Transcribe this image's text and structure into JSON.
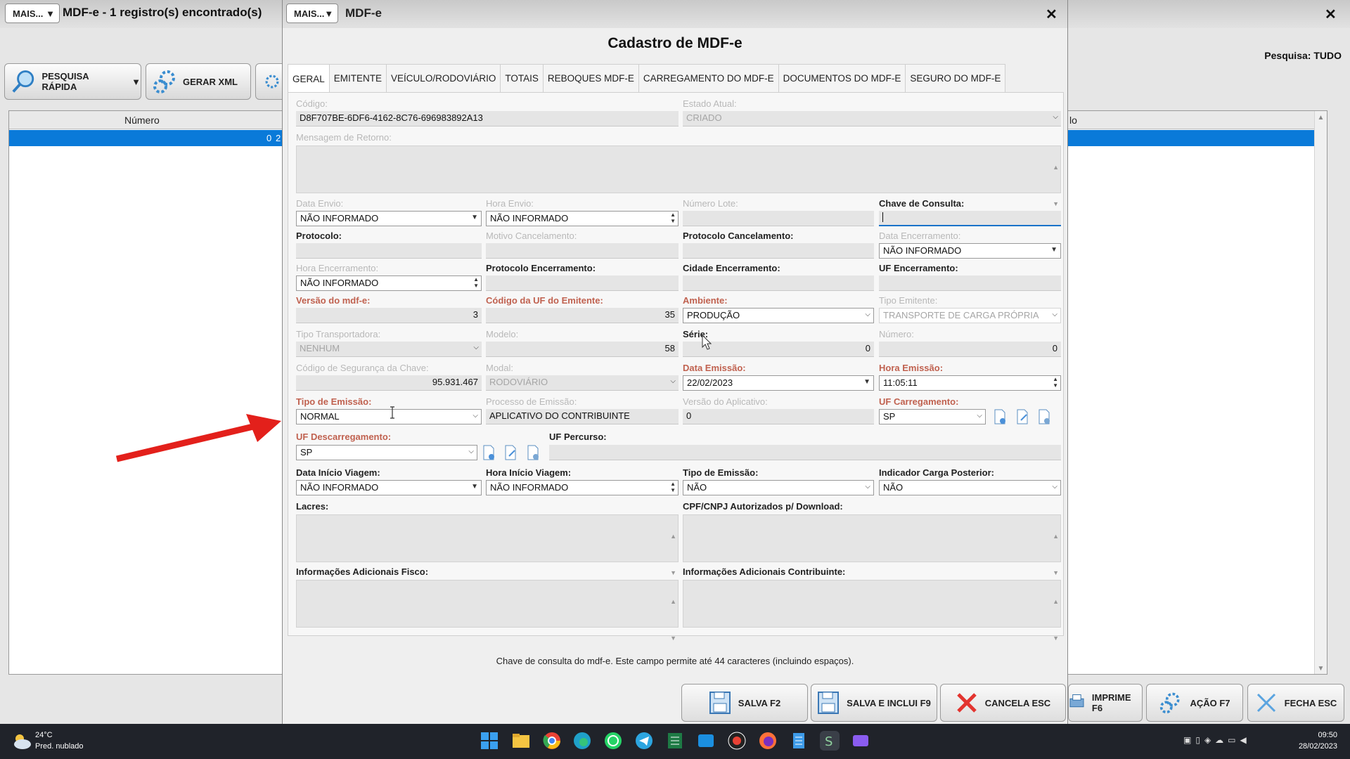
{
  "background_window": {
    "mais_label": "MAIS...",
    "title": "MDF-e - 1 registro(s) encontrado(s)",
    "pesquisa_label": "Pesquisa:",
    "pesquisa_value": "TUDO",
    "toolbar": {
      "pesquisa_rapida": "PESQUISA RÁPIDA",
      "gerar_xml": "GERAR XML"
    },
    "grid": {
      "col_numero": "Número",
      "col_right_partial": "lo",
      "row_value": "0",
      "row_value2": "2"
    },
    "bottom_buttons": {
      "imprime": "IMPRIME F6",
      "acao": "AÇÃO F7",
      "fecha": "FECHA ESC"
    },
    "close_symbol": "✕"
  },
  "modal": {
    "mais_label": "MAIS...",
    "window_title": "MDF-e",
    "dialog_title": "Cadastro de MDF-e",
    "tabs": [
      "GERAL",
      "EMITENTE",
      "VEÍCULO/RODOVIÁRIO",
      "TOTAIS",
      "REBOQUES MDF-E",
      "CARREGAMENTO DO MDF-E",
      "DOCUMENTOS DO MDF-E",
      "SEGURO DO MDF-E"
    ],
    "fields": {
      "codigo_label": "Código:",
      "codigo_value": "D8F707BE-6DF6-4162-8C76-696983892A13",
      "estado_label": "Estado Atual:",
      "estado_value": "CRIADO",
      "mensagem_label": "Mensagem de Retorno:",
      "data_envio_label": "Data Envio:",
      "data_envio_value": "NÃO INFORMADO",
      "hora_envio_label": "Hora Envio:",
      "hora_envio_value": "NÃO INFORMADO",
      "numero_lote_label": "Número Lote:",
      "chave_consulta_label": "Chave de Consulta:",
      "protocolo_label": "Protocolo:",
      "motivo_canc_label": "Motivo Cancelamento:",
      "protocolo_canc_label": "Protocolo Cancelamento:",
      "data_enc_label": "Data Encerramento:",
      "data_enc_value": "NÃO INFORMADO",
      "hora_enc_label": "Hora Encerramento:",
      "hora_enc_value": "NÃO INFORMADO",
      "protocolo_enc_label": "Protocolo Encerramento:",
      "cidade_enc_label": "Cidade Encerramento:",
      "uf_enc_label": "UF Encerramento:",
      "versao_label": "Versão do mdf-e:",
      "versao_value": "3",
      "cod_uf_label": "Código da UF do Emitente:",
      "cod_uf_value": "35",
      "ambiente_label": "Ambiente:",
      "ambiente_value": "PRODUÇÃO",
      "tipo_emitente_label": "Tipo Emitente:",
      "tipo_emitente_value": "TRANSPORTE DE CARGA PRÓPRIA",
      "tipo_transp_label": "Tipo Transportadora:",
      "tipo_transp_value": "NENHUM",
      "modelo_label": "Modelo:",
      "modelo_value": "58",
      "serie_label": "Série:",
      "serie_value": "0",
      "numero_label": "Número:",
      "numero_value": "0",
      "cod_seg_label": "Código de Segurança da Chave:",
      "cod_seg_value": "95.931.467",
      "modal_label": "Modal:",
      "modal_value": "RODOVIÁRIO",
      "data_emissao_label": "Data Emissão:",
      "data_emissao_value": "22/02/2023",
      "hora_emissao_label": "Hora Emissão:",
      "hora_emissao_value": "11:05:11",
      "tipo_emissao_label": "Tipo de Emissão:",
      "tipo_emissao_value": "NORMAL",
      "processo_label": "Processo de Emissão:",
      "processo_value": "APLICATIVO DO CONTRIBUINTE",
      "versao_app_label": "Versão do Aplicativo:",
      "versao_app_value": "0",
      "uf_carreg_label": "UF Carregamento:",
      "uf_carreg_value": "SP",
      "uf_descarreg_label": "UF Descarregamento:",
      "uf_descarreg_value": "SP",
      "uf_percurso_label": "UF Percurso:",
      "data_inicio_label": "Data Início Viagem:",
      "data_inicio_value": "NÃO INFORMADO",
      "hora_inicio_label": "Hora Início Viagem:",
      "hora_inicio_value": "NÃO INFORMADO",
      "tipo_emissao2_label": "Tipo de Emissão:",
      "tipo_emissao2_value": "NÃO",
      "indicador_label": "Indicador Carga Posterior:",
      "indicador_value": "NÃO",
      "lacres_label": "Lacres:",
      "cpf_label": "CPF/CNPJ Autorizados p/ Download:",
      "info_fisco_label": "Informações Adicionais Fisco:",
      "info_contrib_label": "Informações Adicionais Contribuinte:"
    },
    "hint": "Chave de consulta do mdf-e. Este campo permite até 44 caracteres (incluindo espaços).",
    "buttons": {
      "salva": "SALVA F2",
      "salva_inclui": "SALVA E INCLUI F9",
      "cancela": "CANCELA ESC"
    }
  },
  "taskbar": {
    "temp": "24°C",
    "weather": "Pred. nublado",
    "time": "09:50",
    "date": "28/02/2023"
  },
  "colors": {
    "accent": "#0a7ad9",
    "required_label": "#c0614f",
    "arrow": "#e3201b"
  }
}
